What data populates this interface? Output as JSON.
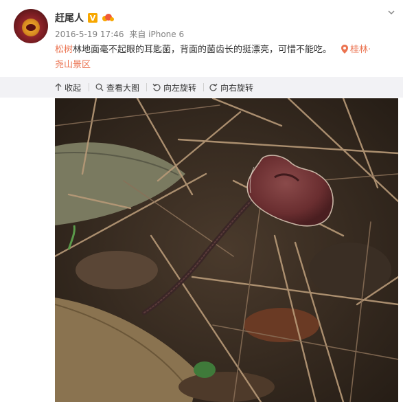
{
  "user": {
    "name": "赶尾人",
    "verified_badge": "V"
  },
  "post": {
    "date": "2016-5-19 17:46",
    "source": "来自 iPhone 6",
    "text_tag": "松树",
    "text_body": "林地面毫不起眼的耳匙菌，背面的菌齿长的挺漂亮，可惜不能吃。",
    "location_part1": "桂林·",
    "location_part2": "尧山景区"
  },
  "toolbar": {
    "collapse_label": "收起",
    "view_large_label": "查看大图",
    "rotate_left_label": "向左旋转",
    "rotate_right_label": "向右旋转"
  },
  "icons": {
    "collapse": "arrow-up-icon",
    "view_large": "magnifier-icon",
    "rotate_left": "rotate-left-icon",
    "rotate_right": "rotate-right-icon",
    "location": "location-pin-icon",
    "menu": "chevron-down-icon"
  },
  "colors": {
    "link": "#eb7350",
    "verified": "#f7a700",
    "toolbar_bg": "#f2f2f5",
    "meta": "#808080"
  }
}
